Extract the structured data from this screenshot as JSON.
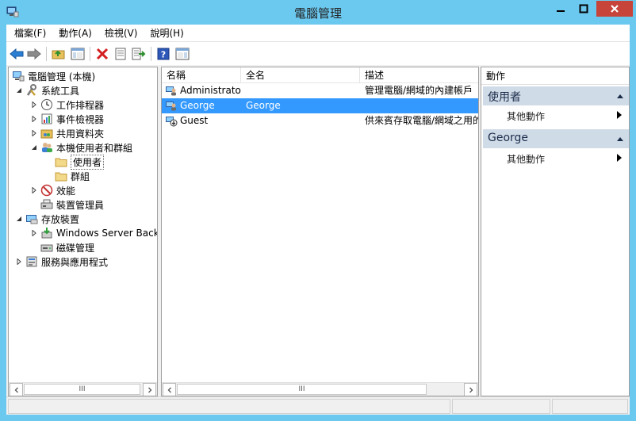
{
  "window": {
    "title": "電腦管理",
    "accent": "#6bc8ef",
    "close_color": "#c7443a",
    "icon": "computer-management-icon"
  },
  "menu": {
    "items": [
      "檔案(F)",
      "動作(A)",
      "檢視(V)",
      "說明(H)"
    ]
  },
  "toolbar": {
    "buttons": [
      "back-arrow-icon",
      "forward-arrow-icon",
      "up-folder-icon",
      "show-hide-tree-icon",
      "delete-icon",
      "properties-icon",
      "export-list-icon",
      "help-icon",
      "show-hide-action-pane-icon"
    ]
  },
  "tree": {
    "nodes": [
      {
        "label": "電腦管理 (本機)",
        "icon": "computer-management-icon"
      },
      {
        "label": "系統工具",
        "icon": "tools-icon"
      },
      {
        "label": "工作排程器",
        "icon": "clock-icon"
      },
      {
        "label": "事件檢視器",
        "icon": "event-viewer-icon"
      },
      {
        "label": "共用資料夾",
        "icon": "shared-folder-icon"
      },
      {
        "label": "本機使用者和群組",
        "icon": "users-groups-icon"
      },
      {
        "label": "使用者",
        "icon": "folder-icon"
      },
      {
        "label": "群組",
        "icon": "folder-icon"
      },
      {
        "label": "效能",
        "icon": "performance-icon"
      },
      {
        "label": "裝置管理員",
        "icon": "device-manager-icon"
      },
      {
        "label": "存放裝置",
        "icon": "storage-icon"
      },
      {
        "label": "Windows Server Backu",
        "icon": "backup-icon"
      },
      {
        "label": "磁碟管理",
        "icon": "disk-icon"
      },
      {
        "label": "服務與應用程式",
        "icon": "services-icon"
      }
    ],
    "scrollbar_thumb_label": "III"
  },
  "list": {
    "columns": [
      "名稱",
      "全名",
      "描述"
    ],
    "rows": [
      {
        "name": "Administrator",
        "full_name": "",
        "description": "管理電腦/網域的內建帳戶",
        "icon": "user-icon"
      },
      {
        "name": "George",
        "full_name": "George",
        "description": "",
        "icon": "user-icon"
      },
      {
        "name": "Guest",
        "full_name": "",
        "description": "供來賓存取電腦/網域之用的",
        "icon": "disabled-user-icon"
      }
    ],
    "selected_row": 1,
    "selection_color": "#3399ff",
    "scrollbar_thumb_label": "III"
  },
  "actions": {
    "title": "動作",
    "sections": [
      {
        "label": "使用者",
        "link": "其他動作"
      },
      {
        "label": "George",
        "link": "其他動作"
      }
    ],
    "section_color": "#d0dbe8"
  }
}
